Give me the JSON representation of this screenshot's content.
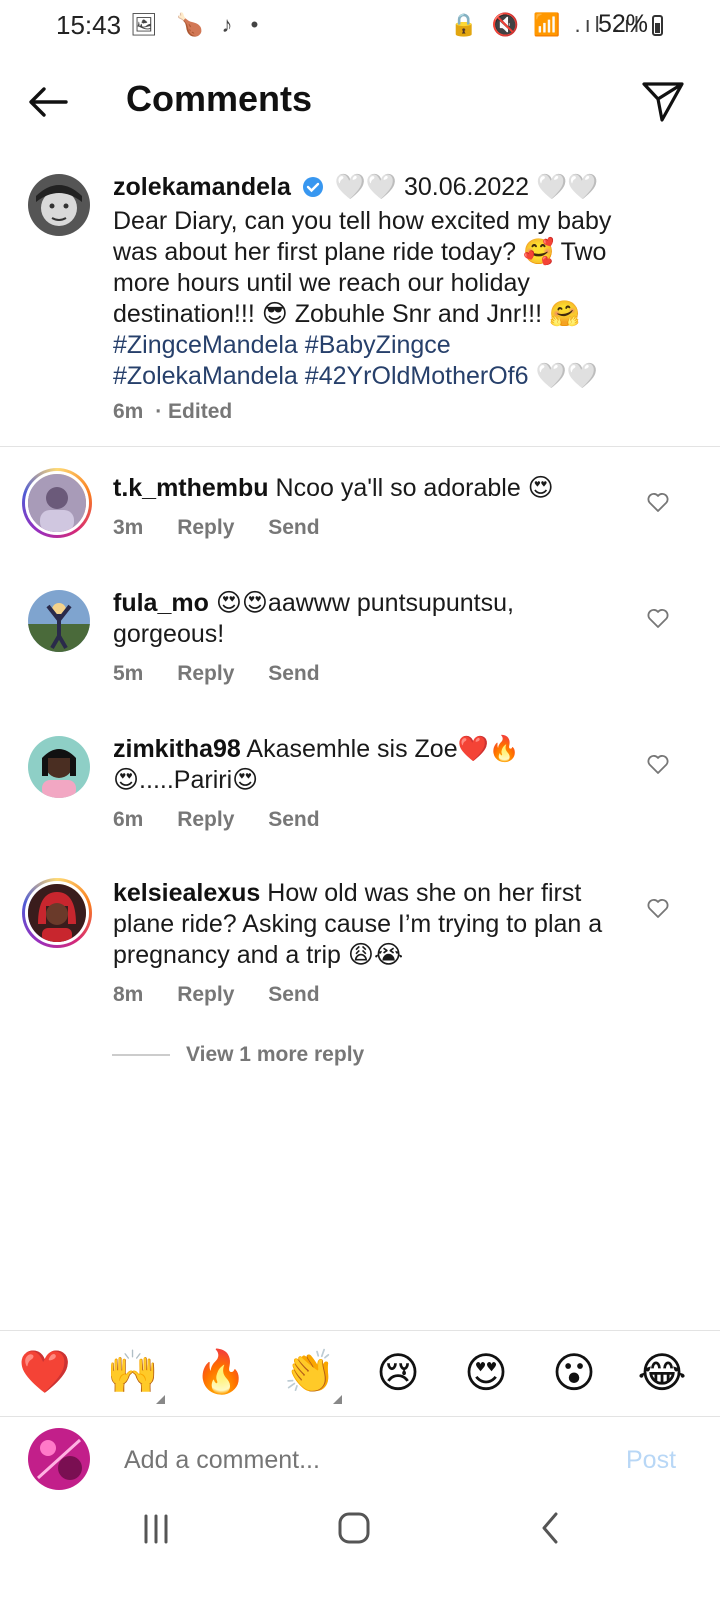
{
  "status_bar": {
    "time": "15:43",
    "battery": "52%",
    "left_icons": "🖼 🍗 ♪ •",
    "right_icons": "🔒 🔇 📶 .ıl .ıl"
  },
  "header": {
    "title": "Comments"
  },
  "caption": {
    "username": "zolekamandela",
    "text_intro": "🤍🤍 30.06.2022 🤍🤍 Dear Diary, can you tell how excited my baby was about her first plane ride today? 🥰 Two more hours until we reach our holiday destination!!! 😎 Zobuhle Snr and Jnr!!! 🤗 ",
    "hashtags": "#ZingceMandela #BabyZingce #ZolekaMandela #42YrOldMotherOf6",
    "text_end": " 🤍🤍",
    "time": "6m",
    "edited": "· Edited"
  },
  "comments": [
    {
      "username": "t.k_mthembu",
      "text": "Ncoo ya'll so adorable 😍",
      "time": "3m",
      "reply": "Reply",
      "send": "Send"
    },
    {
      "username": "fula_mo",
      "text": "😍😍aawww puntsupuntsu, gorgeous!",
      "time": "5m",
      "reply": "Reply",
      "send": "Send"
    },
    {
      "username": "zimkitha98",
      "text": "Akasemhle sis Zoe❤️🔥😍.....Pariri😍",
      "time": "6m",
      "reply": "Reply",
      "send": "Send"
    },
    {
      "username": "kelsiealexus",
      "text": "How old was she on her first plane ride? Asking cause I’m trying to plan a pregnancy and a trip 😩😭",
      "time": "8m",
      "reply": "Reply",
      "send": "Send"
    }
  ],
  "view_more": "View 1 more reply",
  "quick_emojis": [
    "❤️",
    "🙌",
    "🔥",
    "👏",
    "😢",
    "😍",
    "😮",
    "😂"
  ],
  "input": {
    "placeholder": "Add a comment...",
    "post_label": "Post"
  },
  "colors": {
    "hashtag": "#27406b",
    "verified": "#3897f0",
    "post_disabled": "#b8d7f6"
  }
}
